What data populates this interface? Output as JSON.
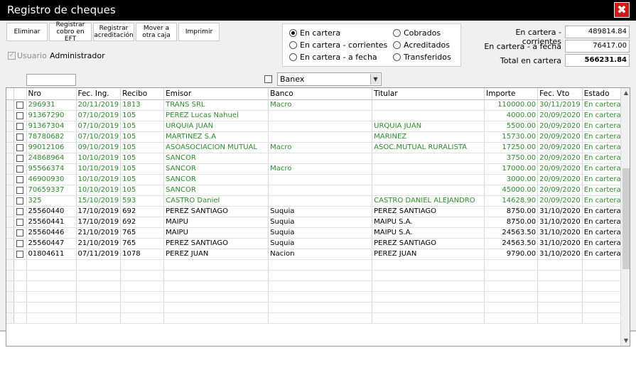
{
  "window": {
    "title": "Registro de cheques",
    "close_symbol": "✖"
  },
  "toolbar": {
    "eliminar": "Eliminar",
    "registrar_eft": "Registrar cobro en EFT",
    "registrar_acreditacion": "Registrar acreditación",
    "mover_caja": "Mover a otra caja",
    "imprimir": "Imprimir"
  },
  "user": {
    "label": "Usuario",
    "name": "Administrador",
    "checked": true
  },
  "filters": {
    "en_cartera": "En cartera",
    "en_cartera_corrientes": "En cartera - corrientes",
    "en_cartera_fecha": "En cartera - a fecha",
    "cobrados": "Cobrados",
    "acreditados": "Acreditados",
    "transferidos": "Transferidos",
    "selected": "En cartera"
  },
  "summary": {
    "corrientes_label": "En cartera - corrientes",
    "corrientes_value": "489814.84",
    "fecha_label": "En cartera - a fecha",
    "fecha_value": "76417.00",
    "total_label": "Total en cartera",
    "total_value": "566231.84"
  },
  "bank_filter": {
    "value": "Banex",
    "checked": false
  },
  "colors": {
    "green_row": "#2e8b2e",
    "close_red": "#cc1a1a"
  },
  "table": {
    "headers": [
      "Nro",
      "Fec. Ing.",
      "Recibo",
      "Emisor",
      "Banco",
      "Titular",
      "Importe",
      "Fec. Vto",
      "Estado"
    ],
    "rows": [
      {
        "nro": "296931",
        "fing": "20/11/2019",
        "recibo": "1813",
        "emisor": "TRANS SRL",
        "banco": "Macro",
        "titular": "",
        "importe": "110000.00",
        "fvto": "30/11/2019",
        "estado": "En cartera",
        "green": true
      },
      {
        "nro": "91367290",
        "fing": "07/10/2019",
        "recibo": "105",
        "emisor": "PEREZ Lucas Nahuel",
        "banco": "",
        "titular": "",
        "importe": "4000.00",
        "fvto": "20/09/2020",
        "estado": "En cartera",
        "green": true
      },
      {
        "nro": "91367304",
        "fing": "07/10/2019",
        "recibo": "105",
        "emisor": "URQUIA JUAN",
        "banco": "",
        "titular": "URQUIA JUAN",
        "importe": "5500.00",
        "fvto": "20/09/2020",
        "estado": "En cartera",
        "green": true
      },
      {
        "nro": "78780682",
        "fing": "07/10/2019",
        "recibo": "105",
        "emisor": "MARTINEZ S.A",
        "banco": "",
        "titular": "MARINEZ",
        "importe": "15730.00",
        "fvto": "20/09/2020",
        "estado": "En cartera",
        "green": true
      },
      {
        "nro": "99012106",
        "fing": "09/10/2019",
        "recibo": "105",
        "emisor": "ASOASOCIACION MUTUAL",
        "banco": "Macro",
        "titular": "ASOC.MUTUAL RURALISTA",
        "importe": "17250.00",
        "fvto": "20/09/2020",
        "estado": "En cartera",
        "green": true
      },
      {
        "nro": "24868964",
        "fing": "10/10/2019",
        "recibo": "105",
        "emisor": "SANCOR",
        "banco": "",
        "titular": "",
        "importe": "3750.00",
        "fvto": "20/09/2020",
        "estado": "En cartera",
        "green": true
      },
      {
        "nro": "95566374",
        "fing": "10/10/2019",
        "recibo": "105",
        "emisor": "SANCOR",
        "banco": "Macro",
        "titular": "",
        "importe": "17000.00",
        "fvto": "20/09/2020",
        "estado": "En cartera",
        "green": true
      },
      {
        "nro": "46900930",
        "fing": "10/10/2019",
        "recibo": "105",
        "emisor": "SANCOR",
        "banco": "",
        "titular": "",
        "importe": "3000.00",
        "fvto": "20/09/2020",
        "estado": "En cartera",
        "green": true
      },
      {
        "nro": "70659337",
        "fing": "10/10/2019",
        "recibo": "105",
        "emisor": "SANCOR",
        "banco": "",
        "titular": "",
        "importe": "45000.00",
        "fvto": "20/09/2020",
        "estado": "En cartera",
        "green": true
      },
      {
        "nro": "325",
        "fing": "15/10/2019",
        "recibo": "593",
        "emisor": "CASTRO Daniel",
        "banco": "",
        "titular": "CASTRO DANIEL ALEJANDRO",
        "importe": "14628.90",
        "fvto": "20/09/2020",
        "estado": "En cartera",
        "green": true
      },
      {
        "nro": "25560440",
        "fing": "17/10/2019",
        "recibo": "692",
        "emisor": "PEREZ SANTIAGO",
        "banco": "Suquia",
        "titular": "PEREZ SANTIAGO",
        "importe": "8750.00",
        "fvto": "31/10/2020",
        "estado": "En cartera",
        "green": false
      },
      {
        "nro": "25560441",
        "fing": "17/10/2019",
        "recibo": "692",
        "emisor": "MAIPU",
        "banco": "Suquia",
        "titular": "MAIPU S.A.",
        "importe": "8750.00",
        "fvto": "31/10/2020",
        "estado": "En cartera",
        "green": false
      },
      {
        "nro": "25560446",
        "fing": "21/10/2019",
        "recibo": "765",
        "emisor": "MAIPU",
        "banco": "Suquia",
        "titular": "MAIPU S.A.",
        "importe": "24563.50",
        "fvto": "31/10/2020",
        "estado": "En cartera",
        "green": false
      },
      {
        "nro": "25560447",
        "fing": "21/10/2019",
        "recibo": "765",
        "emisor": "PEREZ SANTIAGO",
        "banco": "Suquia",
        "titular": "PEREZ SANTIAGO",
        "importe": "24563.50",
        "fvto": "31/10/2020",
        "estado": "En cartera",
        "green": false
      },
      {
        "nro": "01804611",
        "fing": "07/11/2019",
        "recibo": "1078",
        "emisor": "PEREZ JUAN",
        "banco": "Nacion",
        "titular": "PEREZ JUAN",
        "importe": "9790.00",
        "fvto": "31/10/2020",
        "estado": "En cartera",
        "green": false
      }
    ]
  }
}
